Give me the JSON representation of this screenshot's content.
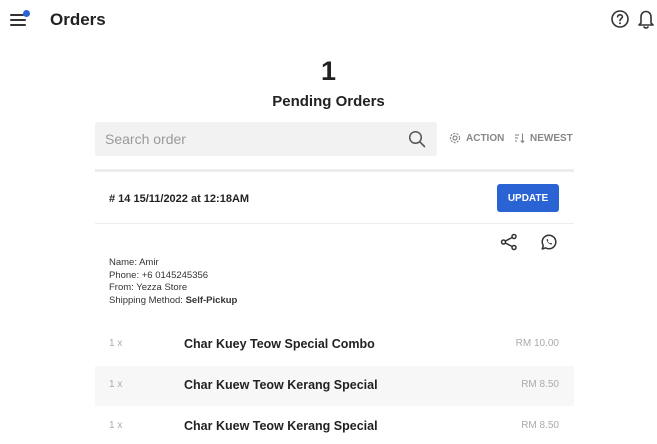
{
  "header": {
    "title": "Orders"
  },
  "summary": {
    "pending_count": "1",
    "pending_label": "Pending Orders"
  },
  "search": {
    "placeholder": "Search order"
  },
  "toolbar": {
    "action_label": "ACTION",
    "sort_label": "NEWEST"
  },
  "order": {
    "id_label": "# 14 15/11/2022 at 12:18AM",
    "update_label": "UPDATE",
    "customer": {
      "name_line": "Name: Amir",
      "phone_line": "Phone: +6 0145245356",
      "from_line": "From: Yezza Store",
      "shipping_prefix": "Shipping Method: ",
      "shipping_value": "Self-Pickup"
    },
    "items": [
      {
        "qty": "1 x",
        "name": "Char Kuey Teow Special Combo",
        "price": "RM 10.00"
      },
      {
        "qty": "1 x",
        "name": "Char Kuew Teow Kerang Special",
        "price": "RM 8.50"
      },
      {
        "qty": "1 x",
        "name": "Char Kuew Teow Kerang Special",
        "price": "RM 8.50"
      }
    ]
  },
  "icons": {
    "menu": "hamburger-menu-icon",
    "help": "help-circle-icon",
    "notifications": "bell-icon",
    "search": "search-icon",
    "action": "gear-icon",
    "sort": "sort-icon",
    "share": "share-icon",
    "whatsapp": "whatsapp-icon"
  },
  "colors": {
    "accent": "#2a63d4",
    "notification_dot": "#2a63d4",
    "muted_text": "#888888"
  }
}
